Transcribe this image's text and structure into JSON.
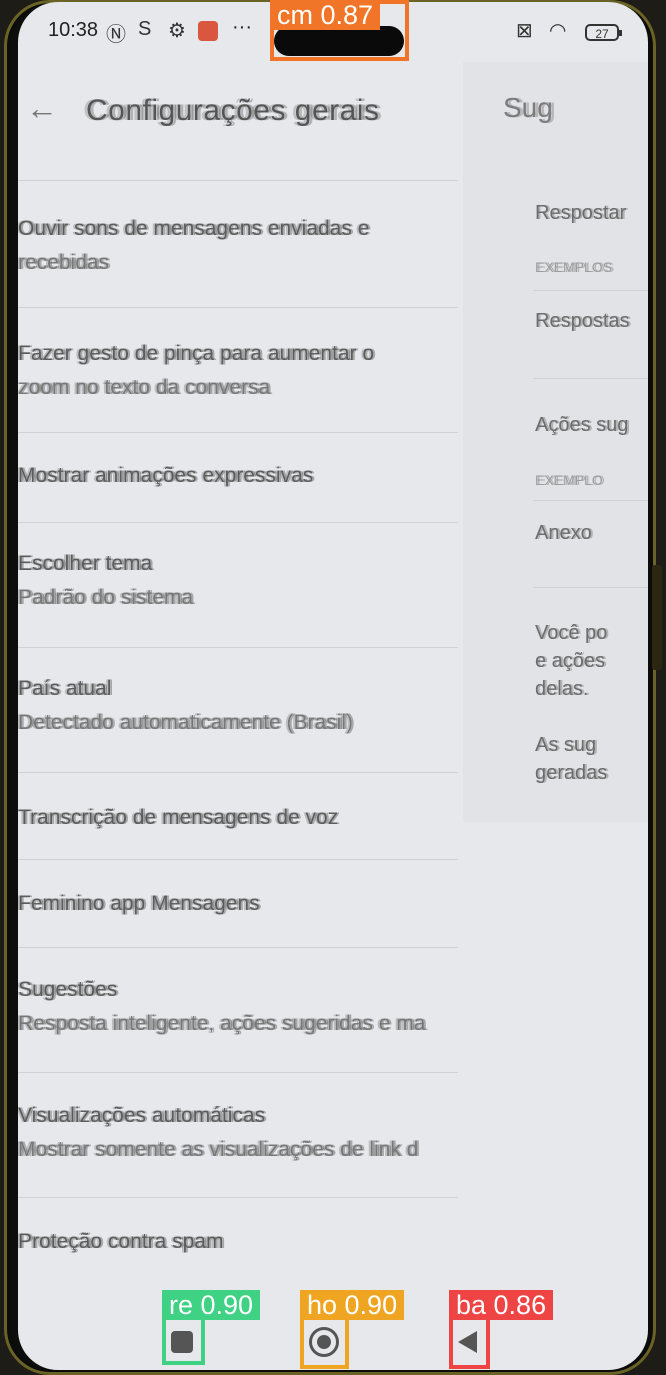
{
  "status_bar": {
    "time": "10:38",
    "icons": [
      "nfc-icon",
      "sync-icon",
      "gear-icon",
      "notification-icon",
      "more-icon",
      "sim-off-icon",
      "wifi-icon"
    ],
    "battery": "27",
    "more": "···"
  },
  "header": {
    "title": "Configurações gerais",
    "back_icon": "arrow-left-icon"
  },
  "settings": [
    {
      "title": "Ouvir sons de mensagens enviadas e",
      "subtitle": "recebidas"
    },
    {
      "title": "Fazer gesto de pinça para aumentar o",
      "subtitle": "zoom no texto da conversa"
    },
    {
      "title": "Mostrar animações expressivas",
      "subtitle": ""
    },
    {
      "title": "Escolher tema",
      "subtitle": "Padrão do sistema"
    },
    {
      "title": "País atual",
      "subtitle": "Detectado automaticamente (Brasil)"
    },
    {
      "title": "Transcrição de mensagens de voz",
      "subtitle": ""
    },
    {
      "title": "Feminino app Mensagens",
      "subtitle": ""
    },
    {
      "title": "Sugestões",
      "subtitle": "Resposta inteligente, ações sugeridas e ma"
    },
    {
      "title": "Visualizações automáticas",
      "subtitle": "Mostrar somente as visualizações de link d"
    },
    {
      "title": "Proteção contra spam",
      "subtitle": ""
    }
  ],
  "right_panel": {
    "title": "Sug",
    "items": [
      "Respostar",
      "EXEMPLOS",
      "Respostas",
      "Ações sug",
      "EXEMPLO",
      "Anexo",
      "Você po",
      "e ações",
      "delas.",
      "As sug",
      "geradas"
    ]
  },
  "detections": {
    "camera": {
      "label": "cm 0.87",
      "color": "#f07528"
    },
    "recents": {
      "label": "re 0.90",
      "color": "#3fd184"
    },
    "home": {
      "label": "ho 0.90",
      "color": "#f0a522"
    },
    "back": {
      "label": "ba 0.86",
      "color": "#ef4444"
    }
  },
  "nav": {
    "recents_icon": "recents-square-icon",
    "home_icon": "home-circle-icon",
    "back_icon": "back-triangle-icon"
  }
}
